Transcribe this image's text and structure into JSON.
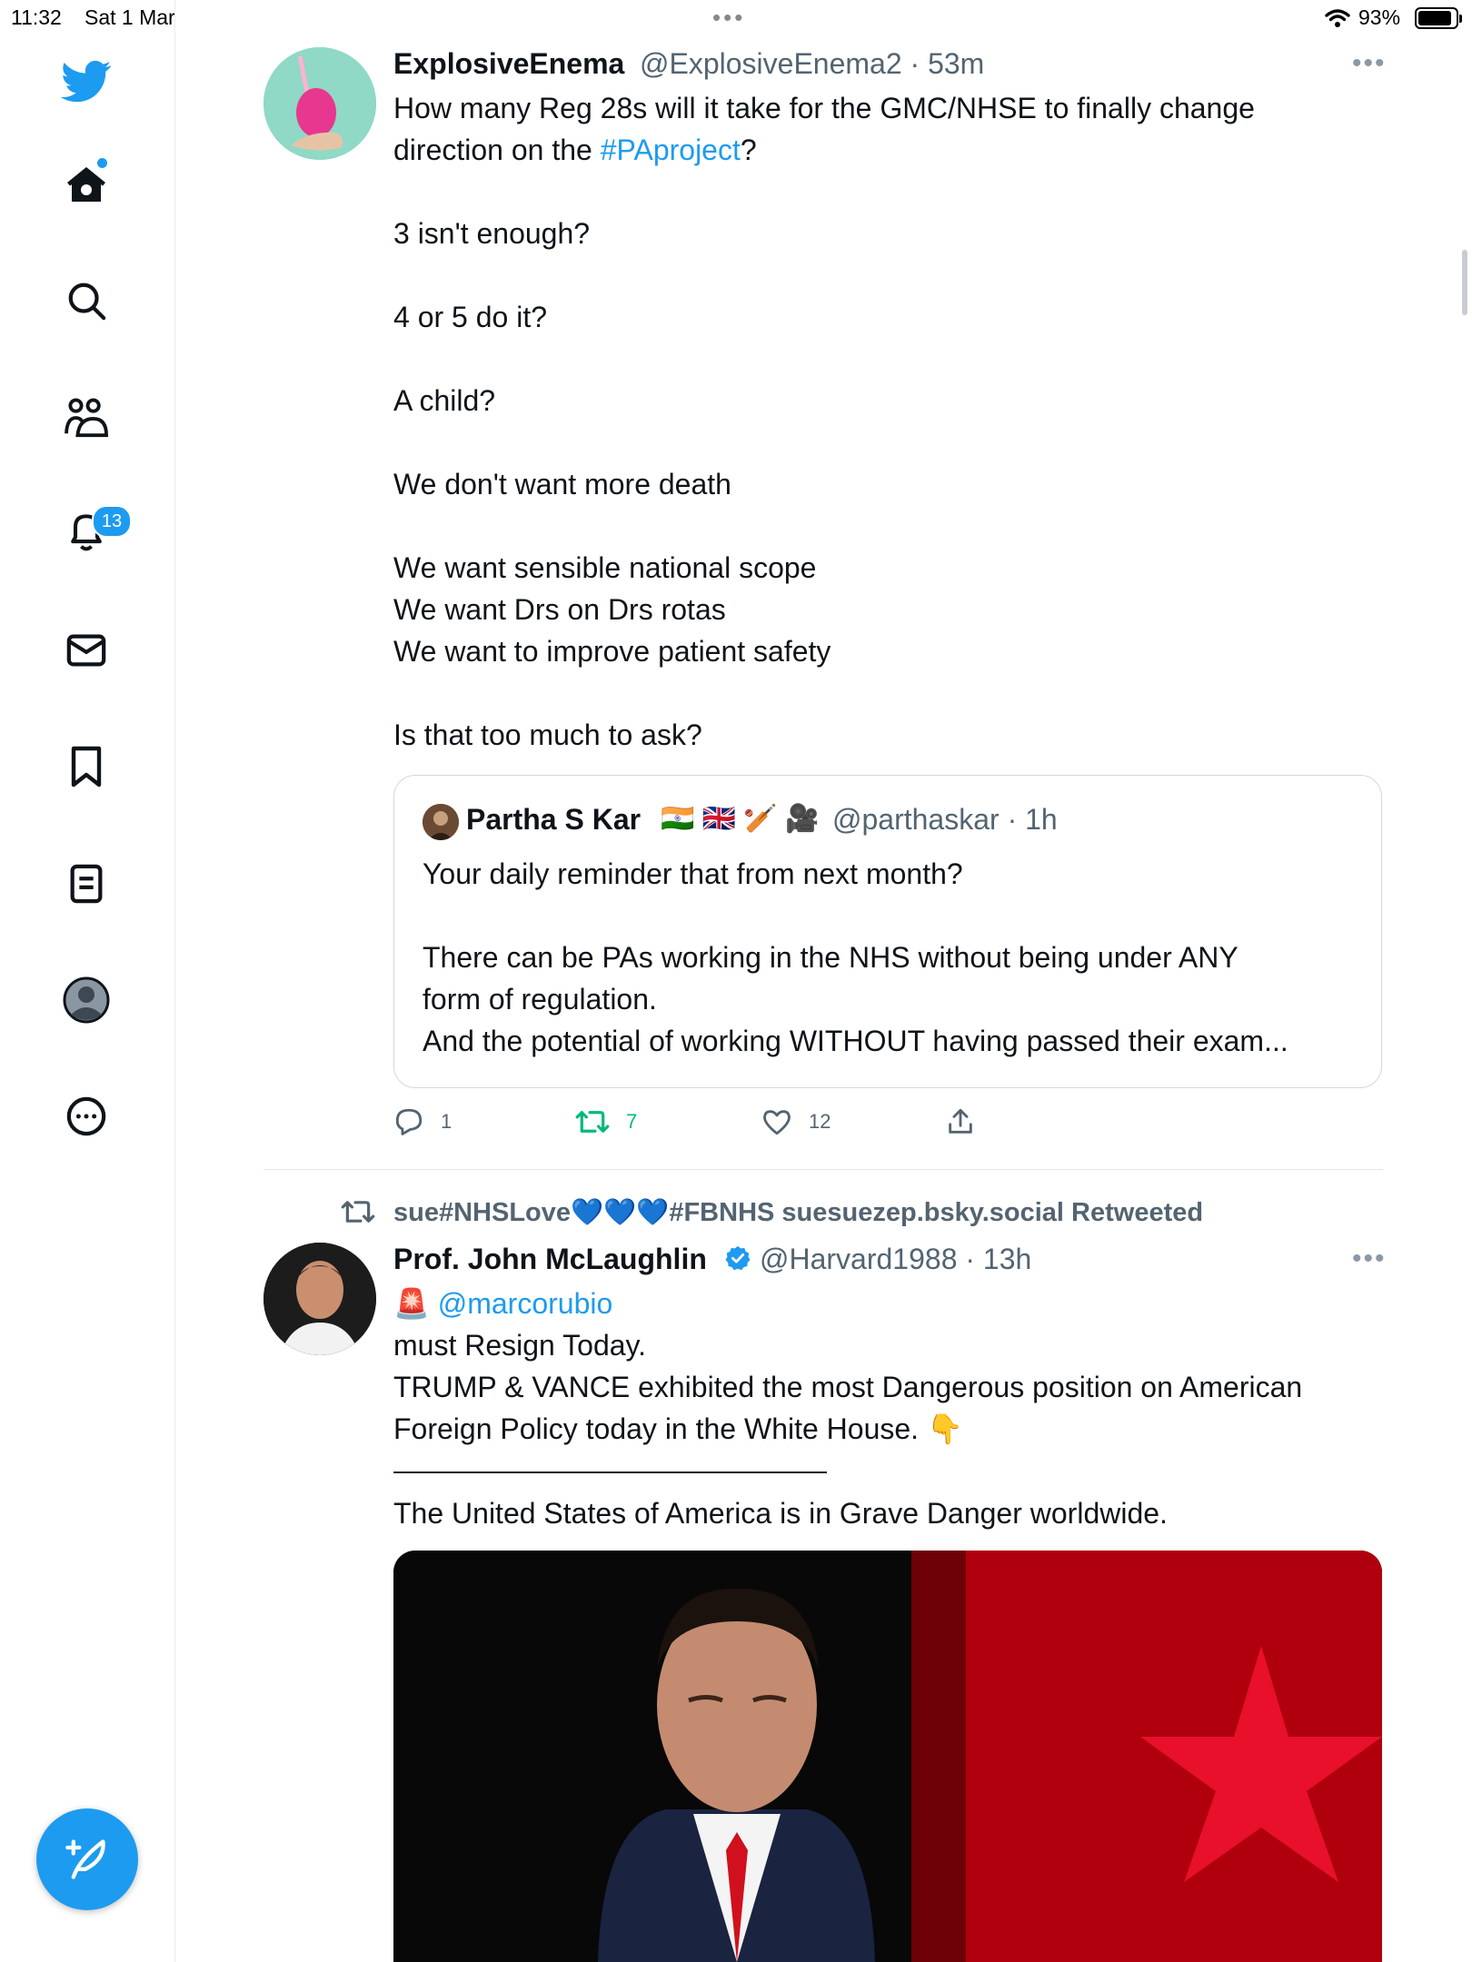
{
  "status_bar": {
    "time": "11:32",
    "date": "Sat 1 Mar",
    "battery": "93%"
  },
  "sidebar": {
    "notifications_badge": "13",
    "items": [
      "twitter-logo",
      "home",
      "search",
      "communities",
      "notifications",
      "messages",
      "bookmarks",
      "lists",
      "profile",
      "more"
    ]
  },
  "tweets": [
    {
      "name": "ExplosiveEnema",
      "handle": "@ExplosiveEnema2 · 53m",
      "body_intro": "How many Reg 28s will it take for the GMC/NHSE to finally change\ndirection on the ",
      "hashtag": "#PAproject",
      "body_after_tag": "?",
      "body_rest": "3 isn't enough?\n\n4 or 5 do it?\n\nA child?\n\nWe don't want more death\n\nWe want sensible national scope\nWe want Drs on Drs rotas\nWe want to improve patient safety\n\nIs that too much to ask?",
      "quote": {
        "name": "Partha S Kar",
        "flags": "🇮🇳 🇬🇧 🏏 🎥",
        "handle": "@parthaskar · 1h",
        "text": "Your daily reminder that from next month?\n\nThere can be PAs working in the NHS without being under ANY\nform of regulation.\nAnd the potential of working WITHOUT having passed their exam..."
      },
      "actions": {
        "replies": "1",
        "retweets": "7",
        "likes": "12"
      }
    },
    {
      "retweeted_by": "sue#NHSLove💙💙💙#FBNHS suesuezep.bsky.social Retweeted",
      "name": "Prof. John McLaughlin",
      "handle": "@Harvard1988 · 13h",
      "siren": "🚨",
      "mention": "@marcorubio",
      "body_lines": "must Resign Today.\nTRUMP & VANCE exhibited the most Dangerous position on American\nForeign Policy today in the White House. 👇",
      "body_after_rule": "The United States of America is in Grave Danger worldwide."
    }
  ],
  "colors": {
    "accent": "#1d9bf0",
    "retweet_green": "#00ba7c",
    "secondary_text": "#536471"
  }
}
